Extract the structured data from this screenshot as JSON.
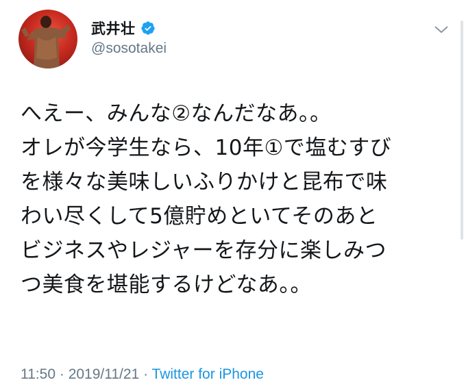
{
  "tweet": {
    "author": {
      "display_name": "武井壮",
      "handle": "@sosotakei",
      "verified": true
    },
    "body_lines": [
      "へえー、みんな②なんだなあ。。",
      "オレが今学生なら、10年①で塩むすび",
      "を様々な美味しいふりかけと昆布で味",
      "わい尽くして5億貯めといてそのあと",
      "ビジネスやレジャーを存分に楽しみつ",
      "つ美食を堪能するけどなあ。。"
    ],
    "time": "11:50",
    "separator": "·",
    "date": "2019/11/21",
    "source": "Twitter for iPhone"
  },
  "colors": {
    "text": "#14171a",
    "secondary": "#657786",
    "link": "#1b95e0",
    "verified_badge": "#1da1f2"
  },
  "icons": {
    "verified": "verified-badge-icon",
    "menu": "chevron-down-icon"
  }
}
